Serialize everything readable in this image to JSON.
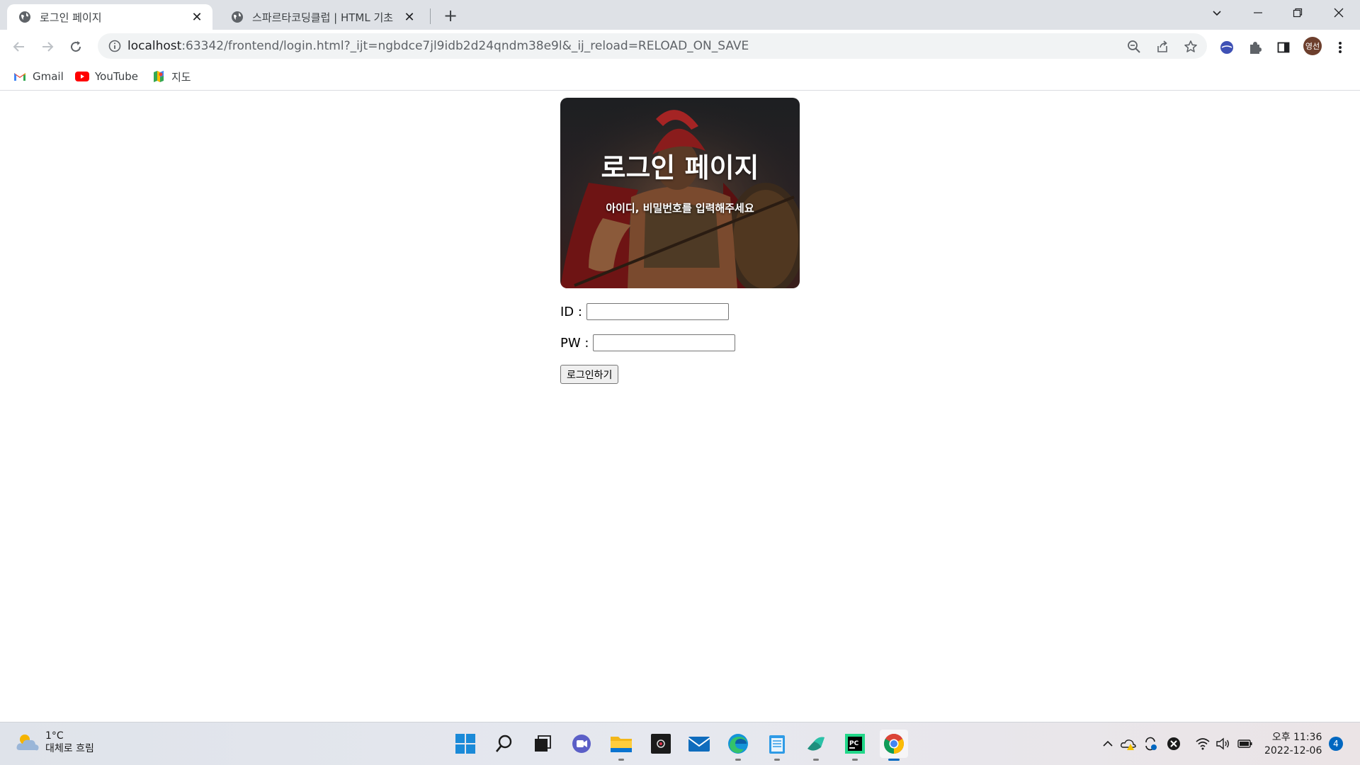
{
  "browser": {
    "tabs": [
      {
        "title": "로그인 페이지",
        "active": true
      },
      {
        "title": "스파르타코딩클럽 | HTML 기초",
        "active": false
      }
    ],
    "address": {
      "host": "localhost",
      "rest": ":63342/frontend/login.html?_ijt=ngbdce7jl9idb2d24qndm38e9l&_ij_reload=RELOAD_ON_SAVE"
    },
    "profile_initials": "영선",
    "bookmarks": [
      {
        "label": "Gmail",
        "icon": "gmail-icon"
      },
      {
        "label": "YouTube",
        "icon": "youtube-icon"
      },
      {
        "label": "지도",
        "icon": "maps-icon"
      }
    ]
  },
  "page": {
    "hero": {
      "title": "로그인 페이지",
      "subtitle": "아이디, 비밀번호를 입력해주세요"
    },
    "form": {
      "id_label": "ID :",
      "id_value": "",
      "pw_label": "PW :",
      "pw_value": "",
      "submit_label": "로그인하기"
    }
  },
  "taskbar": {
    "weather": {
      "temp": "1°C",
      "condition": "대체로 흐림"
    },
    "apps": [
      "start-icon",
      "search-icon",
      "task-view-icon",
      "teams-chat-icon",
      "file-explorer-icon",
      "media-app-icon",
      "mail-icon",
      "edge-icon",
      "notepad-icon",
      "vscode-icon",
      "pycharm-icon",
      "chrome-icon"
    ],
    "clock": {
      "time": "오후 11:36",
      "date": "2022-12-06"
    },
    "notification_count": "4"
  },
  "colors": {
    "accent": "#0067c0",
    "youtube": "#ff0000",
    "avatar": "#6d3f2d"
  }
}
